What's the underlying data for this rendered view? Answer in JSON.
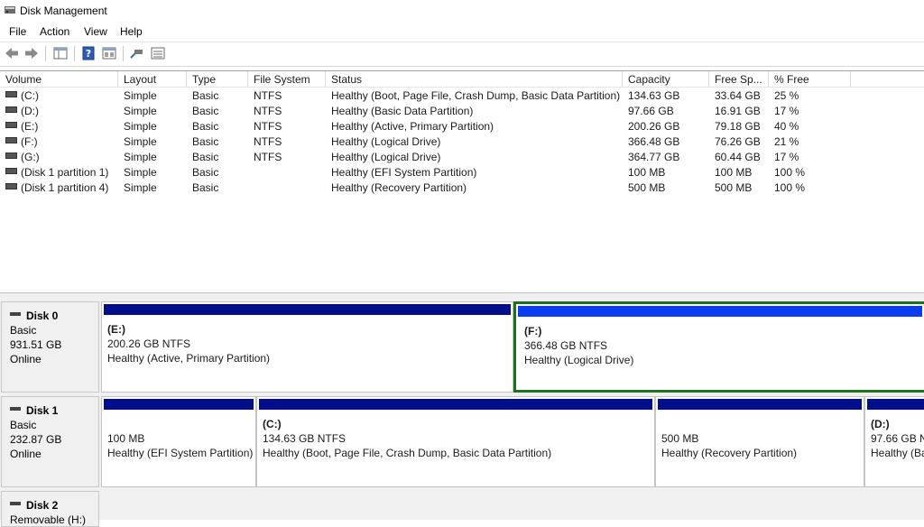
{
  "window": {
    "title": "Disk Management"
  },
  "menu": [
    "File",
    "Action",
    "View",
    "Help"
  ],
  "toolbar": {
    "icons": [
      "back-arrow-icon",
      "forward-arrow-icon",
      "console-tree-icon",
      "help-icon",
      "properties-icon",
      "rescan-disks-icon",
      "volume-list-icon"
    ]
  },
  "volume_list": {
    "columns": [
      "Volume",
      "Layout",
      "Type",
      "File System",
      "Status",
      "Capacity",
      "Free Sp...",
      "% Free"
    ],
    "rows": [
      [
        "(C:)",
        "Simple",
        "Basic",
        "NTFS",
        "Healthy (Boot, Page File, Crash Dump, Basic Data Partition)",
        "134.63 GB",
        "33.64 GB",
        "25 %"
      ],
      [
        "(D:)",
        "Simple",
        "Basic",
        "NTFS",
        "Healthy (Basic Data Partition)",
        "97.66 GB",
        "16.91 GB",
        "17 %"
      ],
      [
        "(E:)",
        "Simple",
        "Basic",
        "NTFS",
        "Healthy (Active, Primary Partition)",
        "200.26 GB",
        "79.18 GB",
        "40 %"
      ],
      [
        "(F:)",
        "Simple",
        "Basic",
        "NTFS",
        "Healthy (Logical Drive)",
        "366.48 GB",
        "76.26 GB",
        "21 %"
      ],
      [
        "(G:)",
        "Simple",
        "Basic",
        "NTFS",
        "Healthy (Logical Drive)",
        "364.77 GB",
        "60.44 GB",
        "17 %"
      ],
      [
        "(Disk 1 partition 1)",
        "Simple",
        "Basic",
        "",
        "Healthy (EFI System Partition)",
        "100 MB",
        "100 MB",
        "100 %"
      ],
      [
        "(Disk 1 partition 4)",
        "Simple",
        "Basic",
        "",
        "Healthy (Recovery Partition)",
        "500 MB",
        "500 MB",
        "100 %"
      ]
    ]
  },
  "disks": [
    {
      "name": "Disk 0",
      "type": "Basic",
      "size": "931.51 GB",
      "status": "Online",
      "partitions": [
        {
          "name": "(E:)",
          "size": "200.26 GB NTFS",
          "status": "Healthy (Active, Primary Partition)",
          "kind": "primary",
          "selected": false
        },
        {
          "name": "(F:)",
          "size": "366.48 GB NTFS",
          "status": "Healthy (Logical Drive)",
          "kind": "logical",
          "selected": true
        }
      ]
    },
    {
      "name": "Disk 1",
      "type": "Basic",
      "size": "232.87 GB",
      "status": "Online",
      "partitions": [
        {
          "name": "",
          "size": "100 MB",
          "status": "Healthy (EFI System Partition)",
          "kind": "primary",
          "selected": false
        },
        {
          "name": "(C:)",
          "size": "134.63 GB NTFS",
          "status": "Healthy (Boot, Page File, Crash Dump, Basic Data Partition)",
          "kind": "primary",
          "selected": false
        },
        {
          "name": "",
          "size": "500 MB",
          "status": "Healthy (Recovery Partition)",
          "kind": "primary",
          "selected": false
        },
        {
          "name": "(D:)",
          "size": "97.66 GB N",
          "status": "Healthy (Ba",
          "kind": "primary",
          "selected": false
        }
      ]
    },
    {
      "name": "Disk 2",
      "type": "Removable (H:)",
      "size": "",
      "status": "",
      "partitions": []
    }
  ],
  "colors": {
    "primary_bar": "#000e8a",
    "logical_bar": "#0b3df0",
    "selection": "#1f6f1f"
  }
}
